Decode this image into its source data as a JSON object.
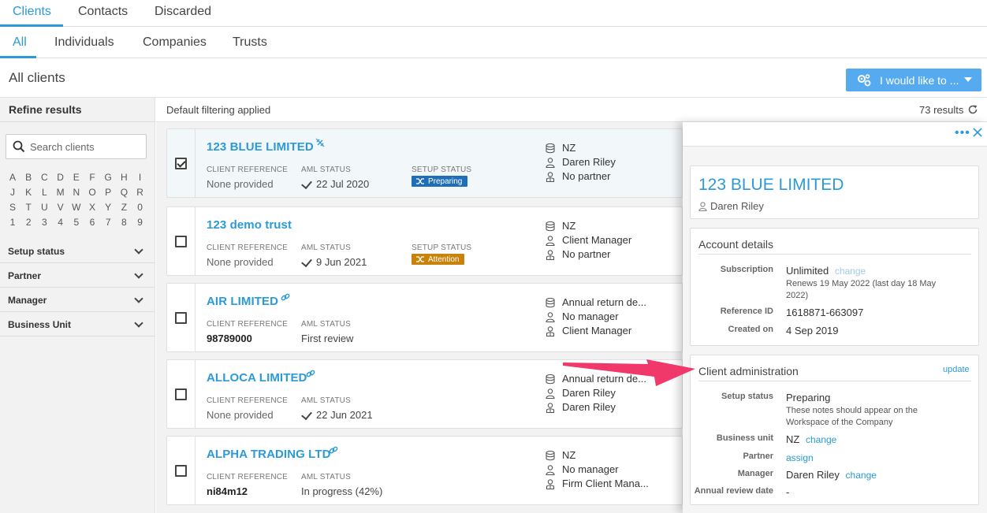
{
  "tabs_primary": {
    "items": [
      "Clients",
      "Contacts",
      "Discarded"
    ],
    "active": "Clients"
  },
  "tabs_secondary": {
    "items": [
      "All",
      "Individuals",
      "Companies",
      "Trusts"
    ],
    "active": "All"
  },
  "page": {
    "title": "All clients",
    "action_button": "I would like to ..."
  },
  "sidebar": {
    "title": "Refine results",
    "search_placeholder": "Search clients",
    "alphabet": [
      "A",
      "B",
      "C",
      "D",
      "E",
      "F",
      "G",
      "H",
      "I",
      "J",
      "K",
      "L",
      "M",
      "N",
      "O",
      "P",
      "Q",
      "R",
      "S",
      "T",
      "U",
      "V",
      "W",
      "X",
      "Y",
      "Z",
      "0",
      "1",
      "2",
      "3",
      "4",
      "5",
      "6",
      "7",
      "8",
      "9"
    ],
    "filters": [
      "Setup status",
      "Partner",
      "Manager",
      "Business Unit"
    ]
  },
  "statusbar": {
    "filter_text": "Default filtering applied",
    "results": "73 results"
  },
  "clients": [
    {
      "name": "123 BLUE LIMITED",
      "icon": "unlink-icon",
      "checked": true,
      "ref_label": "CLIENT REFERENCE",
      "ref": "None provided",
      "aml_label": "AML STATUS",
      "aml": "22 Jul 2020",
      "aml_tick": true,
      "setup_label": "SETUP STATUS",
      "setup": "Preparing",
      "setup_color": "#1f6fb8",
      "meta": [
        "NZ",
        "Daren Riley",
        "No partner"
      ]
    },
    {
      "name": "123 demo trust",
      "icon": "",
      "checked": false,
      "ref_label": "CLIENT REFERENCE",
      "ref": "None provided",
      "aml_label": "AML STATUS",
      "aml": "9 Jun 2021",
      "aml_tick": true,
      "setup_label": "SETUP STATUS",
      "setup": "Attention",
      "setup_color": "#c9820a",
      "meta": [
        "NZ",
        "Client Manager",
        "No partner"
      ]
    },
    {
      "name": "AIR LIMITED",
      "icon": "link-icon",
      "checked": false,
      "ref_label": "CLIENT REFERENCE",
      "ref": "98789000",
      "aml_label": "AML STATUS",
      "aml": "First review",
      "aml_tick": false,
      "setup_label": "",
      "setup": "",
      "setup_color": "",
      "meta": [
        "Annual return de...",
        "No manager",
        "Client Manager"
      ]
    },
    {
      "name": "ALLOCA LIMITED",
      "icon": "link-icon",
      "checked": false,
      "ref_label": "CLIENT REFERENCE",
      "ref": "None provided",
      "aml_label": "AML STATUS",
      "aml": "22 Jun 2021",
      "aml_tick": true,
      "setup_label": "",
      "setup": "",
      "setup_color": "",
      "meta": [
        "Annual return de...",
        "Daren Riley",
        "Daren Riley"
      ]
    },
    {
      "name": "ALPHA TRADING LTD",
      "icon": "link-icon",
      "checked": false,
      "ref_label": "CLIENT REFERENCE",
      "ref": "ni84m12",
      "aml_label": "AML STATUS",
      "aml": "In progress (42%)",
      "aml_tick": false,
      "setup_label": "",
      "setup": "",
      "setup_color": "",
      "meta": [
        "NZ",
        "No manager",
        "Firm Client Mana..."
      ]
    }
  ],
  "panel": {
    "client_name": "123 BLUE LIMITED",
    "client_manager": "Daren Riley",
    "account": {
      "title": "Account details",
      "subscription_label": "Subscription",
      "subscription": "Unlimited",
      "subscription_link": "change",
      "renews": "Renews 19 May 2022 (last day 18 May 2022)",
      "refid_label": "Reference ID",
      "refid": "1618871-663097",
      "created_label": "Created on",
      "created": "4 Sep 2019"
    },
    "admin": {
      "title": "Client administration",
      "update_link": "update",
      "setup_label": "Setup status",
      "setup": "Preparing",
      "setup_note": "These notes should appear on the Workspace of the Company",
      "bu_label": "Business unit",
      "bu": "NZ",
      "bu_link": "change",
      "partner_label": "Partner",
      "partner_link": "assign",
      "manager_label": "Manager",
      "manager": "Daren Riley",
      "manager_link": "change",
      "review_label": "Annual review date",
      "review": "-"
    }
  },
  "colors": {
    "accent": "#2b9ad6",
    "button": "#55aaf0",
    "annotation_arrow": "#f0386b"
  }
}
